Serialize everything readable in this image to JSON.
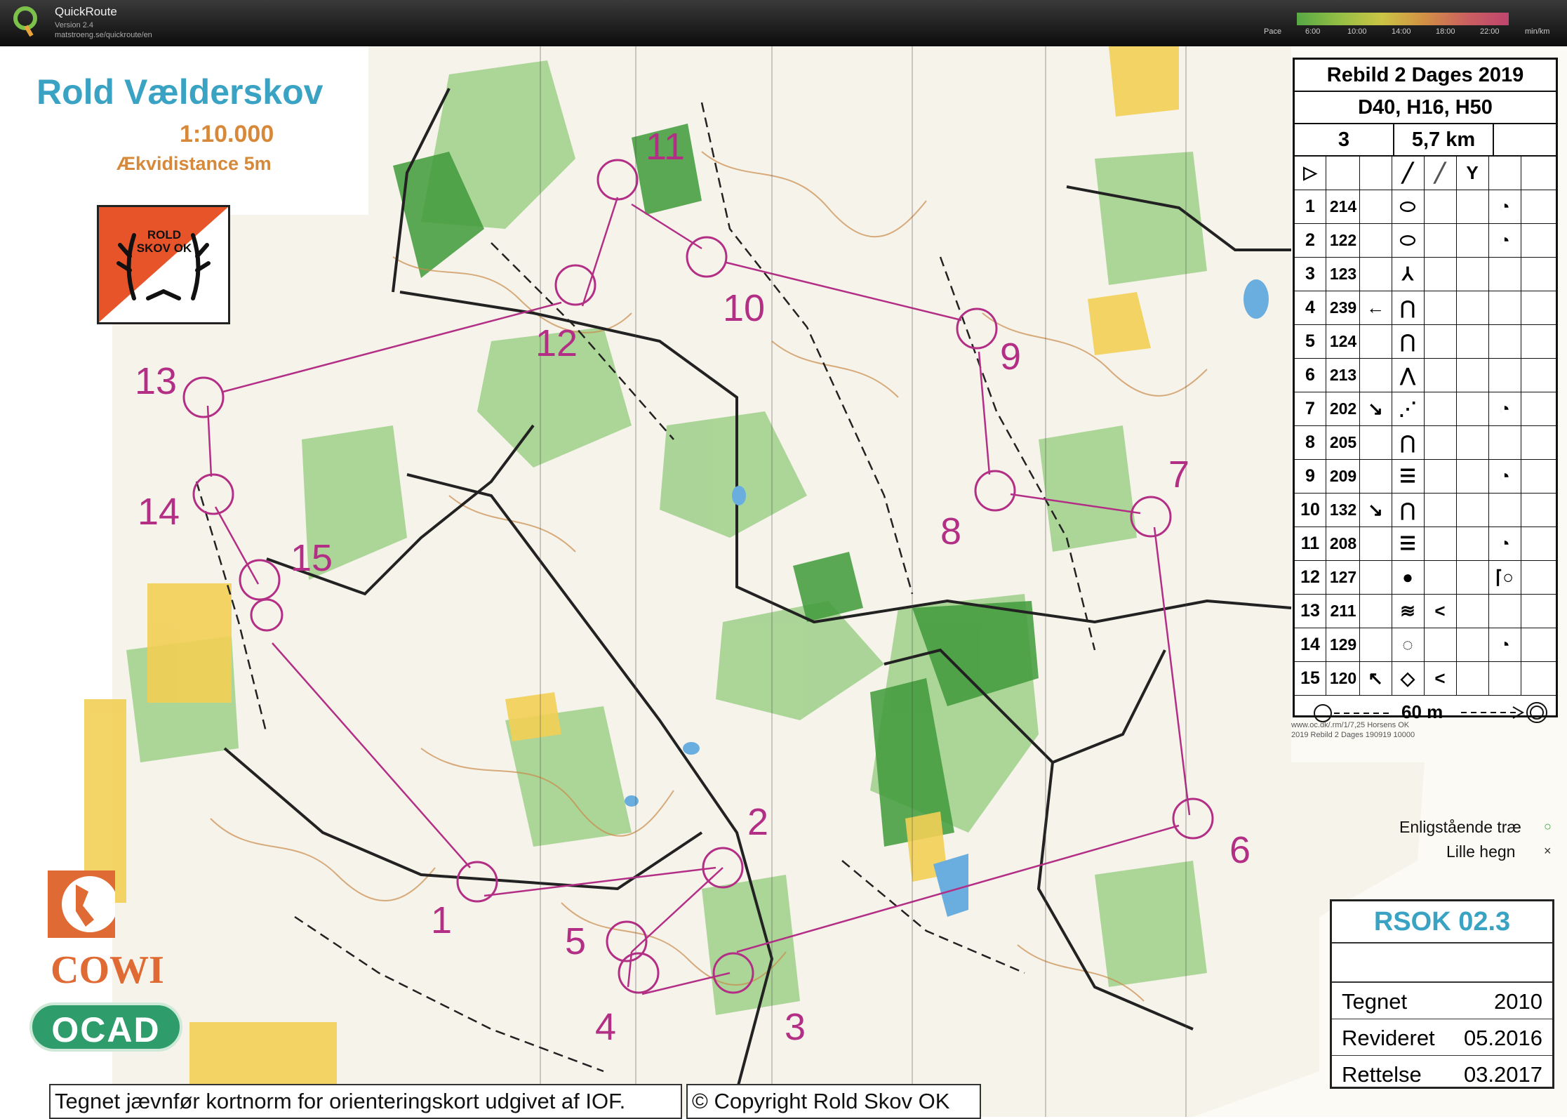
{
  "app": {
    "name": "QuickRoute",
    "version": "Version 2.4",
    "url": "matstroeng.se/quickroute/en",
    "pace_label": "Pace",
    "pace_ticks": [
      "6:00",
      "10:00",
      "14:00",
      "18:00",
      "22:00"
    ],
    "pace_unit": "min/km"
  },
  "map": {
    "title": "Rold Vælderskov",
    "scale": "1:10.000",
    "equidistance": "Ækvidistance 5m",
    "club_logo_text": "ROLD SKOV OK",
    "cowi_text": "COWI",
    "ocad_text": "OCAD",
    "bottom_note": "Tegnet jævnfør kortnorm for orienteringskort udgivet af IOF.",
    "copyright": "© Copyright Rold Skov OK",
    "meta_line1": "www.oc.dk/.rm/1/7,25 Horsens OK",
    "meta_line2": "2019 Rebild 2 Dages 190919 10000",
    "colors": {
      "course": "#b32f86",
      "title": "#3aa3c4",
      "orange": "#d6893a"
    }
  },
  "controls": {
    "numbers": [
      "1",
      "2",
      "3",
      "4",
      "5",
      "6",
      "7",
      "8",
      "9",
      "10",
      "11",
      "12",
      "13",
      "14",
      "15"
    ]
  },
  "description_sheet": {
    "event": "Rebild 2 Dages 2019",
    "classes": "D40, H16, H50",
    "course": "3",
    "length": "5,7 km",
    "rows": [
      {
        "n": "1",
        "code": "214",
        "d": "",
        "e": "⬭",
        "f": "",
        "g": "",
        "h": "◔"
      },
      {
        "n": "2",
        "code": "122",
        "d": "",
        "e": "⬭",
        "f": "",
        "g": "",
        "h": "◔"
      },
      {
        "n": "3",
        "code": "123",
        "d": "",
        "e": "⅄",
        "f": "",
        "g": "",
        "h": ""
      },
      {
        "n": "4",
        "code": "239",
        "d": "←",
        "e": "⋂",
        "f": "",
        "g": "",
        "h": ""
      },
      {
        "n": "5",
        "code": "124",
        "d": "",
        "e": "⋂",
        "f": "",
        "g": "",
        "h": ""
      },
      {
        "n": "6",
        "code": "213",
        "d": "",
        "e": "⋀",
        "f": "",
        "g": "",
        "h": ""
      },
      {
        "n": "7",
        "code": "202",
        "d": "↘",
        "e": "⋰",
        "f": "",
        "g": "",
        "h": "◔"
      },
      {
        "n": "8",
        "code": "205",
        "d": "",
        "e": "⋂",
        "f": "",
        "g": "",
        "h": ""
      },
      {
        "n": "9",
        "code": "209",
        "d": "",
        "e": "☰",
        "f": "",
        "g": "",
        "h": "◔"
      },
      {
        "n": "10",
        "code": "132",
        "d": "↘",
        "e": "⋂",
        "f": "",
        "g": "",
        "h": ""
      },
      {
        "n": "11",
        "code": "208",
        "d": "",
        "e": "☰",
        "f": "",
        "g": "",
        "h": "◔"
      },
      {
        "n": "12",
        "code": "127",
        "d": "",
        "e": "●",
        "f": "",
        "g": "",
        "h": "⌈○"
      },
      {
        "n": "13",
        "code": "211",
        "d": "",
        "e": "≋",
        "f": "<",
        "g": "",
        "h": ""
      },
      {
        "n": "14",
        "code": "129",
        "d": "",
        "e": "◌",
        "f": "",
        "g": "",
        "h": "◔"
      },
      {
        "n": "15",
        "code": "120",
        "d": "↖",
        "e": "◇",
        "f": "<",
        "g": "",
        "h": ""
      }
    ],
    "finish_distance": "60 m",
    "start_symbol": "▷",
    "header_symbols": [
      "╱",
      "╱",
      "Y"
    ]
  },
  "legend": {
    "item1": "Enligstående træ",
    "item1_symbol": "○",
    "item2": "Lille hegn",
    "item2_symbol": "×"
  },
  "info_box": {
    "title": "RSOK 02.3",
    "rows": [
      {
        "label": "Tegnet",
        "value": "2010"
      },
      {
        "label": "Revideret",
        "value": "05.2016"
      },
      {
        "label": "Rettelse",
        "value": "03.2017"
      }
    ]
  }
}
